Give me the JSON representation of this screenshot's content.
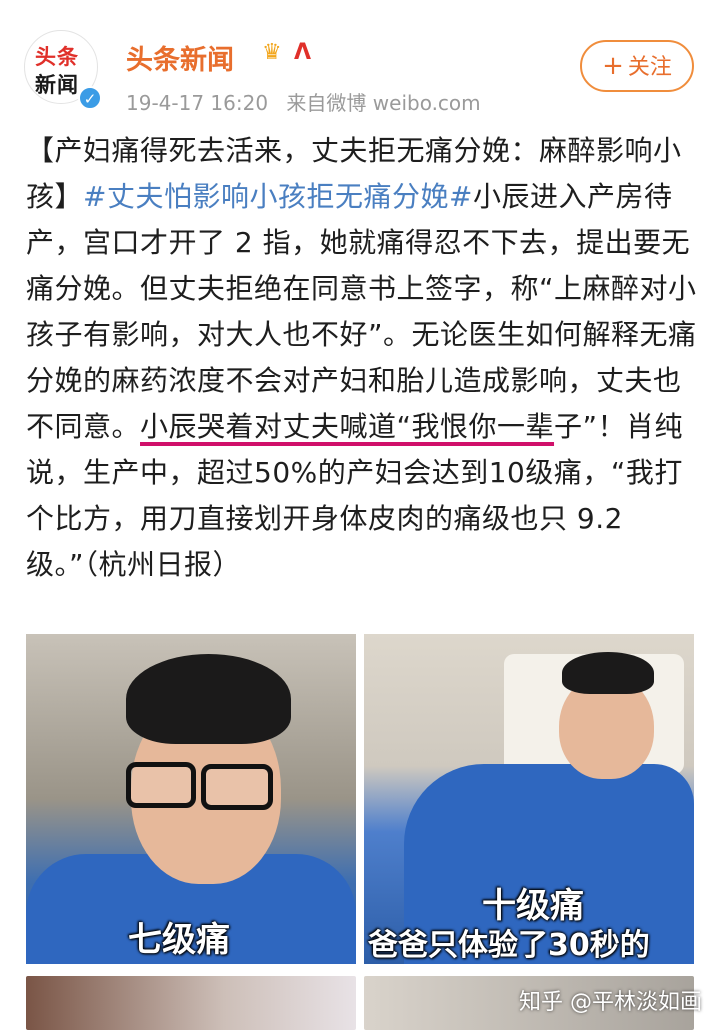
{
  "account": {
    "avatar_line1": "头条",
    "avatar_line2": "新闻",
    "verified_mark": "✓",
    "name": "头条新闻",
    "crown_icon": "♛",
    "vip_icon": "Ʌ",
    "time": "19-4-17 16:20",
    "source": "来自微博 weibo.com"
  },
  "follow_button": {
    "plus": "+",
    "label": "关注"
  },
  "post": {
    "part1": "【产妇痛得死去活来，丈夫拒无痛分娩：麻醉影响小孩】",
    "hashtag": "#丈夫怕影响小孩拒无痛分娩#",
    "part2": "小辰进入产房待产，宫口才开了 2 指，她就痛得忍不下去，提出要无痛分娩。但丈夫拒绝在同意书上签字，称“上麻醉对小孩子有影响，对大人也不好”。无论医生如何解释无痛分娩的麻药浓度不会对产妇和胎儿造成影响，丈夫也不同意。",
    "underlined": "小辰哭着对丈夫喊道“我恨你一辈",
    "part3": "子”！肖纯说，生产中，超过50%的产妇会达到10级痛，“我打个比方，用刀直接划开身体皮肉的痛级也只 9.2级。”（杭州日报）"
  },
  "images": {
    "left_caption": "七级痛",
    "right_caption_1": "十级痛",
    "right_caption_2": "爸爸只体验了30秒的"
  },
  "footer": {
    "watermark": "知乎 @平林淡如画"
  },
  "colors": {
    "name": "#e86e2d",
    "hashtag": "#4a7fc1",
    "underline": "#d0106a",
    "verify": "#3b9ce6"
  }
}
